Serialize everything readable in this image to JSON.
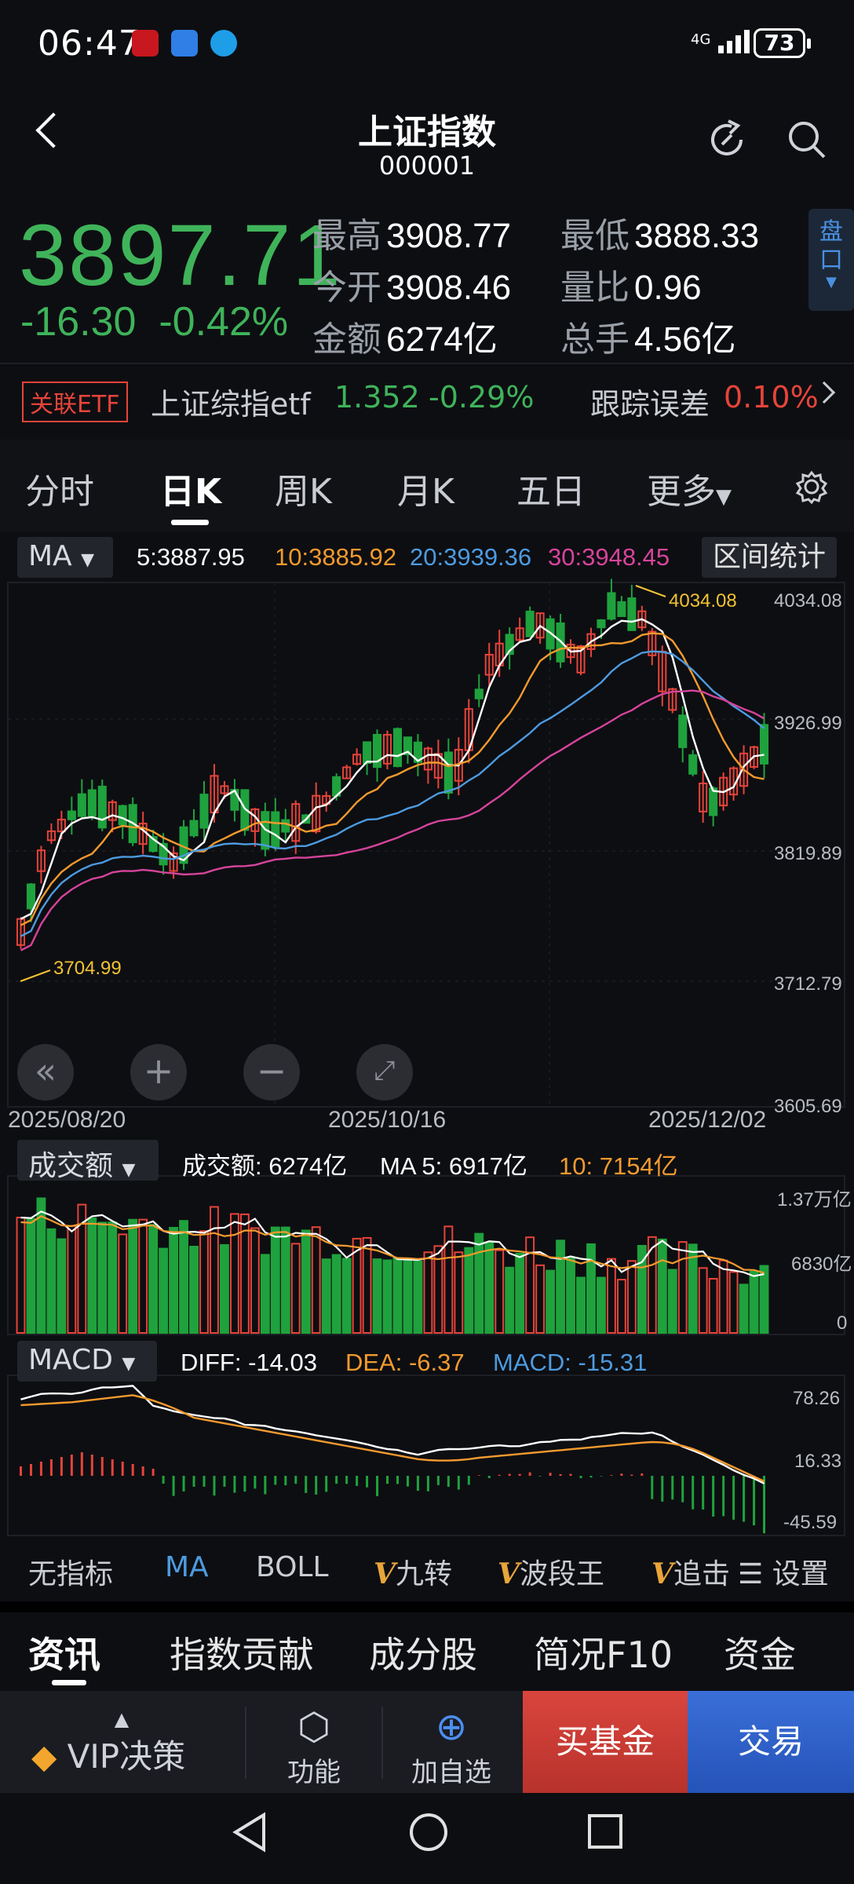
{
  "status_bar": {
    "time": "06:47",
    "network": "4G",
    "battery": "73"
  },
  "header": {
    "title": "上证指数",
    "code": "000001"
  },
  "quote": {
    "price": "3897.71",
    "change": "-16.30",
    "change_pct": "-0.42%",
    "high_label": "最高",
    "high": "3908.77",
    "low_label": "最低",
    "low": "3888.33",
    "open_label": "今开",
    "open": "3908.46",
    "vol_ratio_label": "量比",
    "vol_ratio": "0.96",
    "amount_label": "金额",
    "amount": "6274亿",
    "total_hands_label": "总手",
    "total_hands": "4.56亿",
    "pankou": "盘口"
  },
  "etf": {
    "tag": "关联ETF",
    "name": "上证综指etf",
    "price": "1.352",
    "change_pct": "-0.29%",
    "tracking_label": "跟踪误差",
    "tracking_value": "0.10%"
  },
  "tabs": [
    {
      "label": "分时"
    },
    {
      "label": "日K"
    },
    {
      "label": "周K"
    },
    {
      "label": "月K"
    },
    {
      "label": "五日"
    },
    {
      "label": "更多"
    }
  ],
  "ma_row": {
    "selector": "MA",
    "ma5": "5:3887.95",
    "ma10": "10:3885.92",
    "ma20": "20:3939.36",
    "ma30": "30:3948.45",
    "stats_button": "区间统计"
  },
  "colors": {
    "up": "#e6443a",
    "down": "#1fa23d",
    "ma5": "#ffffff",
    "ma10": "#f39a2e",
    "ma20": "#4d9be0",
    "ma30": "#d6449b",
    "highlight": "#f2c232"
  },
  "kline_axis": {
    "y_labels": [
      "4034.08",
      "3926.99",
      "3819.89",
      "3712.79",
      "3605.69"
    ],
    "dates": [
      "2025/08/20",
      "2025/10/16",
      "2025/12/02"
    ],
    "max_marker": "4034.08",
    "min_marker": "3704.99"
  },
  "volume": {
    "selector": "成交额",
    "value": "成交额: 6274亿",
    "ma5": "MA 5: 6917亿",
    "ma10": "10: 7154亿",
    "y_labels": [
      "1.37万亿",
      "6830亿",
      "0"
    ]
  },
  "macd": {
    "selector": "MACD",
    "diff": "DIFF: -14.03",
    "dea": "DEA: -6.37",
    "macd": "MACD: -15.31",
    "y_labels": [
      "78.26",
      "16.33",
      "-45.59"
    ]
  },
  "indicator_bar": {
    "items": [
      "无指标",
      "MA",
      "BOLL",
      "九转",
      "波段王",
      "追击"
    ],
    "settings": "设置"
  },
  "news_tabs": [
    "资讯",
    "指数贡献",
    "成分股",
    "简况F10",
    "资金"
  ],
  "bottom_nav": {
    "vip": "VIP决策",
    "func": "功能",
    "add": "加自选",
    "buy_fund": "买基金",
    "trade": "交易"
  }
}
